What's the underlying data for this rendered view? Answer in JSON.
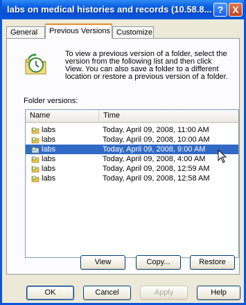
{
  "window": {
    "title": "labs on medical histories and records (10.58.8...",
    "help_button": "?",
    "close_button": "X"
  },
  "tabs": [
    {
      "label": "General",
      "active": false
    },
    {
      "label": "Previous Versions",
      "active": true
    },
    {
      "label": "Customize",
      "active": false
    }
  ],
  "intro": {
    "icon": "clock-folder-icon",
    "text": "To view a previous version of a folder, select the version from the following list and then click View.  You can also save a folder to a different location or restore a previous version of a folder."
  },
  "folder_versions_label": "Folder versions:",
  "list": {
    "columns": [
      "Name",
      "Time"
    ],
    "rows": [
      {
        "name": "labs",
        "time": "Today, April 09, 2008, 11:00 AM",
        "selected": false
      },
      {
        "name": "labs",
        "time": "Today, April 09, 2008, 10:00 AM",
        "selected": false
      },
      {
        "name": "labs",
        "time": "Today, April 09, 2008, 9:00 AM",
        "selected": true
      },
      {
        "name": "labs",
        "time": "Today, April 09, 2008, 4:00 AM",
        "selected": false
      },
      {
        "name": "labs",
        "time": "Today, April 09, 2008, 12:59 AM",
        "selected": false
      },
      {
        "name": "labs",
        "time": "Today, April 09, 2008, 12:58 AM",
        "selected": false
      }
    ]
  },
  "actions": {
    "view": "View",
    "copy": "Copy...",
    "restore": "Restore"
  },
  "dialog_buttons": {
    "ok": "OK",
    "cancel": "Cancel",
    "apply": "Apply",
    "help": "Help"
  },
  "colors": {
    "titlebar": "#0a59d8",
    "selection": "#316ac5",
    "active_tab_accent": "#e68b2c"
  }
}
